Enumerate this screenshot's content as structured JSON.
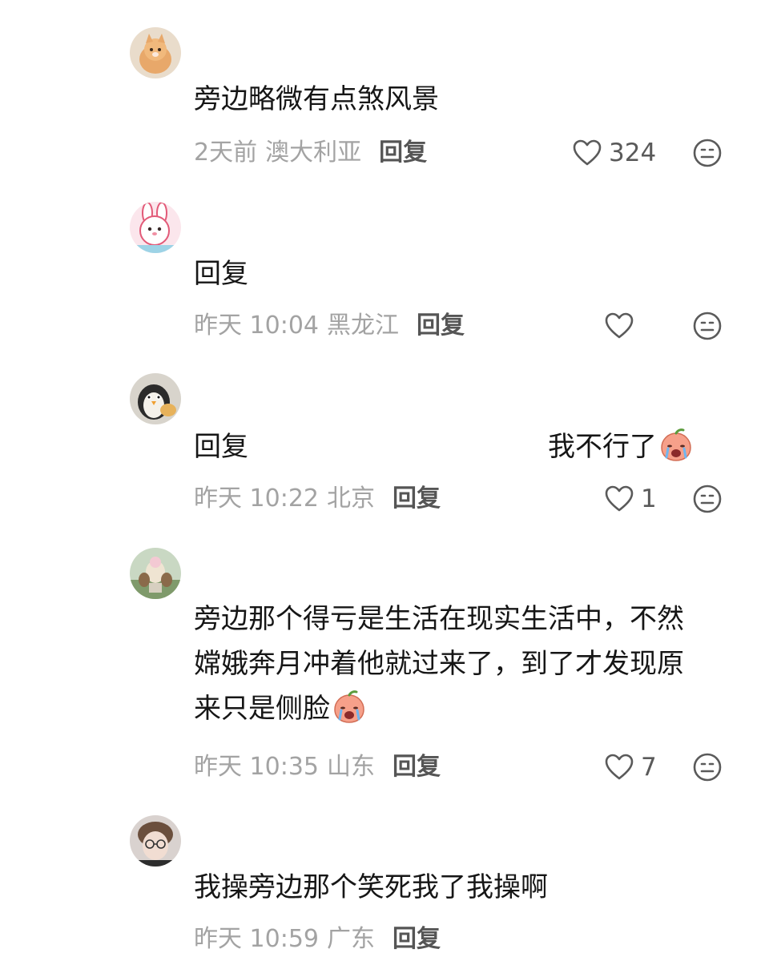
{
  "comments": [
    {
      "text": "旁边略微有点煞风景",
      "time": "2天前",
      "location": "澳大利亚",
      "reply_label": "回复",
      "likes": "324",
      "avatar": "orange-cat-avatar"
    },
    {
      "text": "回复",
      "time": "昨天 10:04",
      "location": "黑龙江",
      "reply_label": "回复",
      "likes": "",
      "avatar": "cartoon-bunny-avatar"
    },
    {
      "text_prefix": "回复",
      "text_suffix": "我不行了",
      "emoji": "crying-peach-emoji",
      "time": "昨天 10:22",
      "location": "北京",
      "reply_label": "回复",
      "likes": "1",
      "avatar": "penguin-avatar"
    },
    {
      "lines": [
        "旁边那个得亏是生活在现实生活中，不然",
        "嫦娥奔月冲着他就过来了，到了才发现原",
        "来只是侧脸"
      ],
      "emoji": "crying-peach-emoji",
      "time": "昨天 10:35",
      "location": "山东",
      "reply_label": "回复",
      "likes": "7",
      "avatar": "figure-photo-avatar"
    },
    {
      "text": "我操旁边那个笑死我了我操啊",
      "time": "昨天 10:59",
      "location": "广东",
      "reply_label": "回复",
      "avatar": "person-glasses-avatar"
    }
  ],
  "colors": {
    "text": "#161616",
    "meta": "#a3a3a3",
    "reply": "#555555",
    "icon": "#5a5a5a",
    "emoji_peach": "#f6a08a"
  }
}
